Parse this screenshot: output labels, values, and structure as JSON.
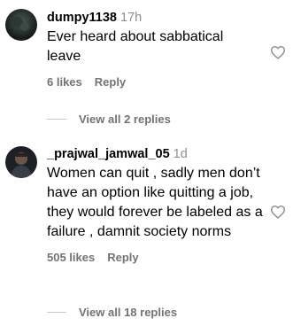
{
  "comments": [
    {
      "username": "dumpy1138",
      "time": "17h",
      "text": "Ever heard about sabbatical leave",
      "likes": "6 likes",
      "reply": "Reply",
      "view_replies": "View all 2 replies",
      "avatar": "dark-photo-avatar",
      "like_icon": "heart-outline-icon"
    },
    {
      "username": "_prajwal_jamwal_05",
      "time": "1d",
      "text": "Women can quit , sadly men don’t have an option like quitting a job, they would forever be labeled as a failure , damnit society norms",
      "likes": "505 likes",
      "reply": "Reply",
      "view_replies": "View all 18 replies",
      "avatar": "person-photo-avatar",
      "like_icon": "heart-outline-icon"
    }
  ]
}
